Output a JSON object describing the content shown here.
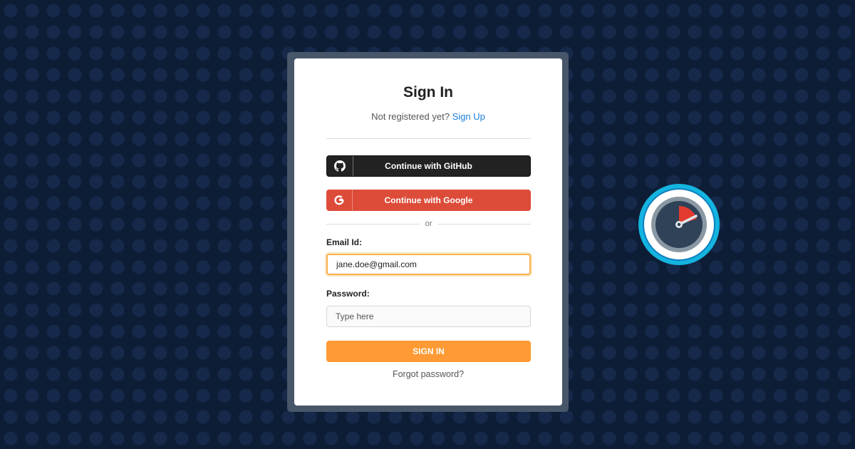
{
  "signin": {
    "title": "Sign In",
    "not_registered": "Not registered yet?",
    "signup_link": "Sign Up",
    "github_button": "Continue with GitHub",
    "google_button": "Continue with Google",
    "or_text": "or",
    "email_label": "Email Id:",
    "email_value": "jane.doe@gmail.com",
    "password_label": "Password:",
    "password_placeholder": "Type here",
    "submit_button": "SIGN IN",
    "forgot_link": "Forgot password?"
  },
  "icons": {
    "github": "github-icon",
    "google": "google-icon",
    "logo": "stopwatch-logo"
  },
  "colors": {
    "background": "#0d1d36",
    "github": "#222222",
    "google": "#dd4b39",
    "accent": "#ff9a34",
    "link": "#1a7fd6",
    "logo_ring": "#14b4e0"
  }
}
